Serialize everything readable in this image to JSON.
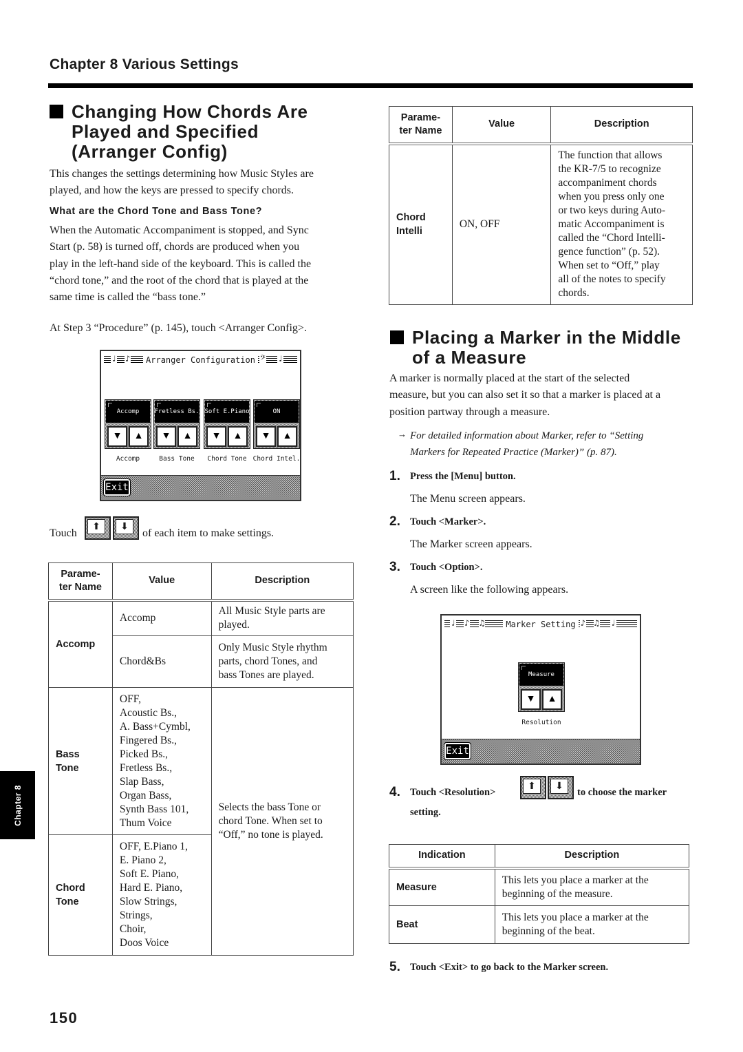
{
  "header": {
    "chapter": "Chapter 8 Various Settings"
  },
  "section1": {
    "title": "Changing How  Chords Are\nPlayed and Specified\n(Arranger Config)",
    "intro": [
      "This changes the settings determining how Music Styles are",
      "played, and how the keys are pressed to specify chords."
    ],
    "subheading": "What are the Chord Tone and Bass Tone?",
    "explanation": [
      "When the Automatic Accompaniment is stopped, and Sync",
      "Start (p. 58) is turned off, chords are produced when you",
      "play in the left-hand side of the keyboard. This is called the",
      "“chord tone,” and the root of the chord that is played at the",
      "same time is called the “bass tone.”"
    ],
    "step_intro": "At Step 3 “Procedure” (p. 145), touch <Arranger Config>.",
    "screen": {
      "title": "Arranger Configuration",
      "params": [
        {
          "value": "Accomp",
          "label": "Accomp"
        },
        {
          "value": "Fretless Bs.",
          "label": "Bass Tone"
        },
        {
          "value": "Soft E.Piano",
          "label": "Chord Tone"
        },
        {
          "value": "ON",
          "label": "Chord Intel."
        }
      ],
      "up_arrow": "🠕",
      "down_arrow": "🠗",
      "exit_label": "Exit"
    },
    "touch_line": {
      "prefix": "Touch",
      "suffix": "of each item to make settings.",
      "up_icon": "⬆",
      "down_icon": "⬇"
    },
    "table": {
      "headers": [
        "Parame-\nter Name",
        "Value",
        "Description"
      ],
      "accomp": {
        "name": "Accomp",
        "rows": [
          {
            "value": "Accomp",
            "description": "All Music Style parts are\nplayed."
          },
          {
            "value": "Chord&Bs",
            "description": "Only Music Style rhythm\nparts, chord Tones, and\nbass Tones are played."
          }
        ]
      },
      "bass_tone": {
        "name": "Bass\nTone",
        "value": "OFF,\nAcoustic Bs.,\nA. Bass+Cymbl,\nFingered Bs.,\nPicked Bs.,\nFretless Bs.,\nSlap Bass,\nOrgan Bass,\nSynth Bass 101,\nThum Voice"
      },
      "chord_tone": {
        "name": "Chord\nTone",
        "value": "OFF, E.Piano 1,\nE. Piano 2,\nSoft E. Piano,\nHard E. Piano,\nSlow Strings,\nStrings,\nChoir,\nDoos Voice"
      },
      "shared_description": "Selects the bass Tone or\nchord Tone. When set to\n“Off,” no tone is played."
    }
  },
  "right_table": {
    "headers": [
      "Parame-\nter Name",
      "Value",
      "Description"
    ],
    "row": {
      "name": "Chord\nIntelli",
      "value": "ON, OFF",
      "description": "The function that allows\nthe KR-7/5 to recognize\naccompaniment chords\nwhen you press only one\nor two keys during Auto-\nmatic Accompaniment is\ncalled the “Chord Intelli-\ngence function” (p. 52).\nWhen set to “Off,” play\nall of the notes to specify\nchords."
    }
  },
  "section2": {
    "title": "Placing a Marker in the Middle\nof a Measure",
    "intro": [
      "A marker is normally placed at the start of the selected",
      "measure, but you can also set it so that a marker is placed at a",
      "position partway through a measure."
    ],
    "note_arrow": "→",
    "note": [
      "For detailed information about Marker, refer to “Setting",
      "Markers for Repeated Practice (Marker)” (p. 87)."
    ],
    "steps": [
      {
        "num": "1.",
        "text": "Press the [Menu] button.",
        "result": "The Menu screen appears."
      },
      {
        "num": "2.",
        "text": "Touch <Marker>.",
        "result": "The Marker screen appears."
      },
      {
        "num": "3.",
        "text": "Touch <Option>.",
        "result": "A screen like the following appears."
      },
      {
        "num": "4.",
        "text_prefix": "Touch <Resolution>",
        "text_suffix": "to choose the marker",
        "text_cont": "setting."
      },
      {
        "num": "5.",
        "text": "Touch <Exit> to go back to the Marker screen."
      }
    ],
    "screen": {
      "title": "Marker Setting",
      "value": "Measure",
      "label": "Resolution",
      "exit_label": "Exit"
    },
    "table": {
      "headers": [
        "Indication",
        "Description"
      ],
      "rows": [
        {
          "indication": "Measure",
          "description": "This lets you place a marker at the\nbeginning of the measure."
        },
        {
          "indication": "Beat",
          "description": "This lets you place a marker at the\nbeginning of the beat."
        }
      ]
    }
  },
  "sidebar_tab": "Chapter 8",
  "page_number": "150"
}
